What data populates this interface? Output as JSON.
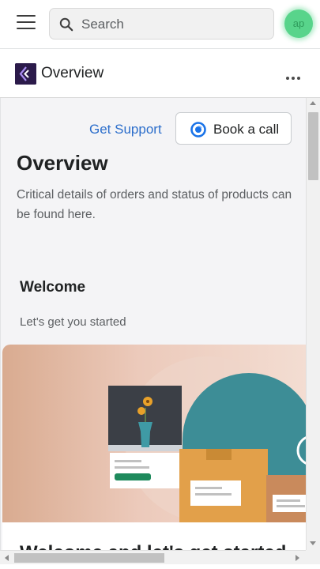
{
  "topbar": {
    "menu_icon": "hamburger-menu-icon",
    "search_icon": "search-icon",
    "search_placeholder": "Search",
    "search_value": "",
    "avatar_initials": "ap",
    "avatar_color": "#58d48b"
  },
  "header": {
    "page_name": "Overview",
    "logo_icon": "app-logo-icon",
    "more_icon": "more-horizontal-icon"
  },
  "main": {
    "support_link": "Get Support",
    "book_call_label": "Book a call",
    "book_call_icon": "calendly-icon",
    "title": "Overview",
    "description": "Critical details of orders and status of products can be found here.",
    "welcome_title": "Welcome",
    "welcome_subtitle": "Let's get you started",
    "card_heading": "Welcome and let's get started"
  },
  "colors": {
    "link": "#2c6ecb",
    "page_bg": "#f4f4f6",
    "accent_green": "#1e8a5c",
    "teal": "#3d8d96",
    "box": "#e2a04a"
  }
}
